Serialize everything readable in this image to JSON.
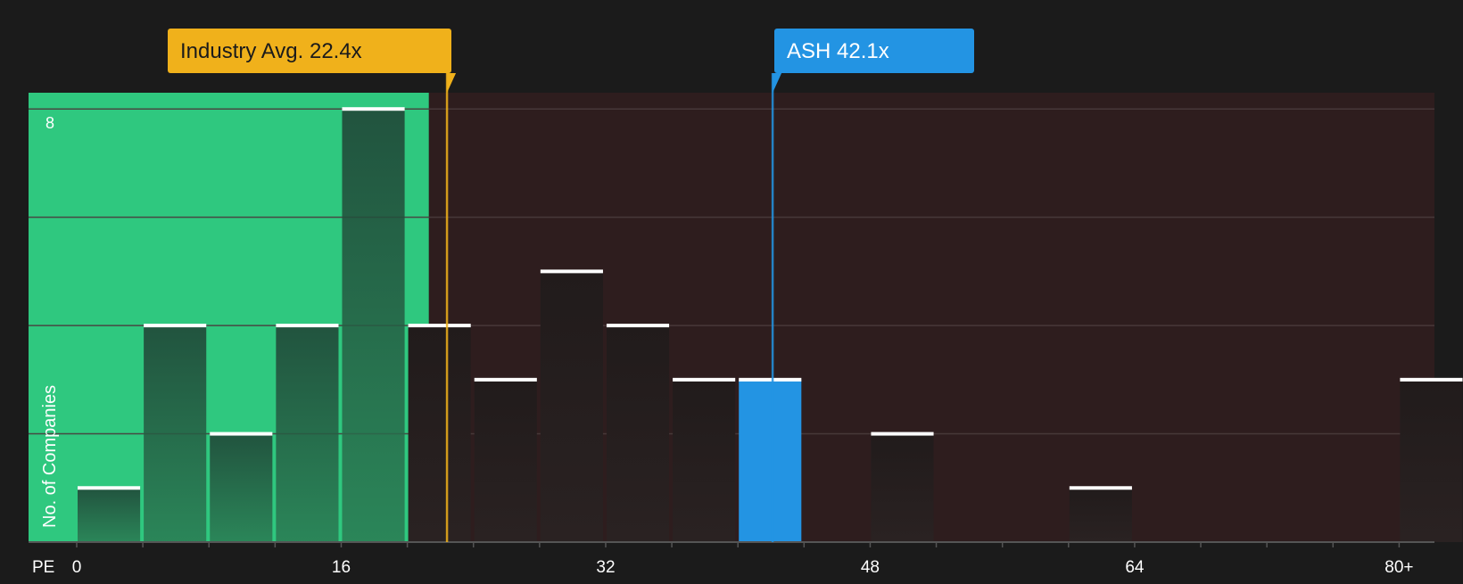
{
  "chart_data": {
    "type": "bar",
    "ylabel": "No. of Companies",
    "xlabel": "PE",
    "x_ticks": [
      {
        "value": 0,
        "label": "0"
      },
      {
        "value": 16,
        "label": "16"
      },
      {
        "value": 32,
        "label": "32"
      },
      {
        "value": 48,
        "label": "48"
      },
      {
        "value": 64,
        "label": "64"
      },
      {
        "value": 80,
        "label": "80+"
      }
    ],
    "y_ticks": [
      {
        "value": 8,
        "label": "8"
      }
    ],
    "xlim": [
      0,
      82
    ],
    "ylim": [
      0,
      8.3
    ],
    "bin_width": 4,
    "bins": [
      {
        "start": 0,
        "value": 1
      },
      {
        "start": 4,
        "value": 4
      },
      {
        "start": 8,
        "value": 2
      },
      {
        "start": 12,
        "value": 4
      },
      {
        "start": 16,
        "value": 8
      },
      {
        "start": 20,
        "value": 4
      },
      {
        "start": 24,
        "value": 3
      },
      {
        "start": 28,
        "value": 5
      },
      {
        "start": 32,
        "value": 4
      },
      {
        "start": 36,
        "value": 3
      },
      {
        "start": 40,
        "value": 3,
        "highlight": true
      },
      {
        "start": 44,
        "value": 0
      },
      {
        "start": 48,
        "value": 2
      },
      {
        "start": 52,
        "value": 0
      },
      {
        "start": 56,
        "value": 0
      },
      {
        "start": 60,
        "value": 1
      },
      {
        "start": 64,
        "value": 0
      },
      {
        "start": 68,
        "value": 0
      },
      {
        "start": 72,
        "value": 0
      },
      {
        "start": 76,
        "value": 0
      },
      {
        "start": 80,
        "value": 3
      }
    ],
    "undervalued_zone_end": 21.3,
    "industry_avg": {
      "value": 22.4,
      "label": "Industry Avg. 22.4x",
      "color": "#f0b11b"
    },
    "company": {
      "value": 42.1,
      "label": "ASH 42.1x",
      "color": "#2394e3"
    },
    "colors": {
      "background": "#1b1b1b",
      "plot_background": "#2e1d1e",
      "green_zone": "#2fc87f",
      "bar_green_top": "#214a3b",
      "bar_dark": "#261f1f",
      "bar_highlight": "#2394e3",
      "bar_cap": "#ffffff",
      "grid": "#4a3b3c"
    }
  }
}
